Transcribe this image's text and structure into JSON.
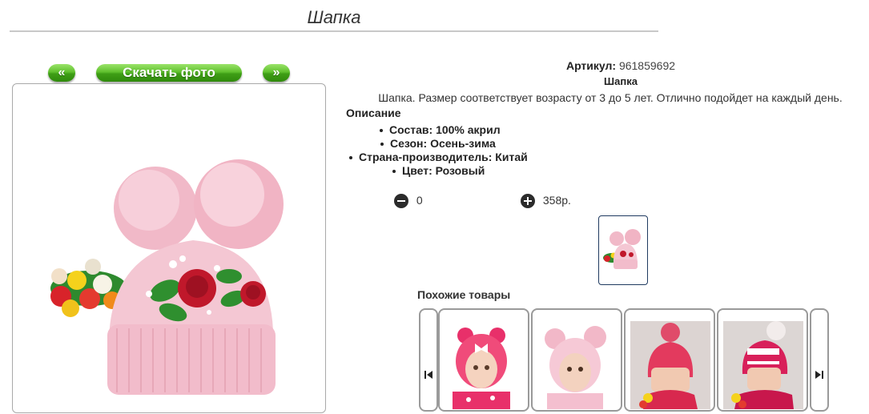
{
  "header": {
    "title": "Шапка"
  },
  "gallery": {
    "prev_label": "«",
    "download_label": "Скачать фото",
    "next_label": "»"
  },
  "product": {
    "article_label": "Артикул:",
    "article_value": "961859692",
    "name": "Шапка",
    "description": "Шапка. Размер соответствует возрасту от 3 до 5 лет. Отлично подойдет на каждый день.",
    "description_heading": "Описание",
    "attributes": [
      "Состав: 100% акрил",
      "Сезон: Осень-зима",
      "Страна-производитель: Китай",
      "Цвет: Розовый"
    ]
  },
  "cart": {
    "quantity": "0",
    "price": "358р."
  },
  "similar": {
    "heading": "Похожие товары"
  },
  "colors": {
    "button_green": "#4fb321",
    "hat_pink": "#f2c4d0",
    "rose_red": "#c0182b",
    "thumb_border": "#1f3a60"
  },
  "icons": [
    "minus-circle-icon",
    "plus-circle-icon",
    "skip-prev-icon",
    "skip-next-icon"
  ]
}
